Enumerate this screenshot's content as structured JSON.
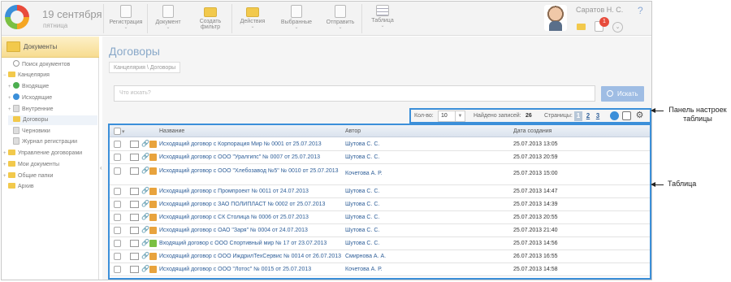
{
  "header": {
    "date": "19 сентября",
    "weekday": "пятница",
    "toolbar": [
      {
        "label": "Регистрация",
        "icon": "register-doc-icon"
      },
      {
        "label": "Документ",
        "icon": "document-icon"
      },
      {
        "label": "Создать\nфильтр",
        "icon": "filter-folder-icon"
      },
      {
        "label": "Действия",
        "icon": "actions-folder-icon"
      },
      {
        "label": "Выбранные",
        "icon": "selected-icon"
      },
      {
        "label": "Отправить",
        "icon": "send-icon"
      },
      {
        "label": "Таблица",
        "icon": "table-icon"
      }
    ],
    "user_name": "Саратов Н. С.",
    "help": "?",
    "tasks_badge": "1"
  },
  "sidebar": {
    "title": "Документы",
    "items": [
      {
        "label": "Поиск документов",
        "level": 1,
        "icon": "search"
      },
      {
        "label": "Канцелярия",
        "level": 0,
        "icon": "folder",
        "pm": "−"
      },
      {
        "label": "Входящие",
        "level": 1,
        "icon": "incoming",
        "pm": "+"
      },
      {
        "label": "Исходящие",
        "level": 1,
        "icon": "outgoing",
        "pm": "+"
      },
      {
        "label": "Внутренние",
        "level": 1,
        "icon": "doc",
        "pm": "+"
      },
      {
        "label": "Договоры",
        "level": 1,
        "icon": "folder",
        "active": true
      },
      {
        "label": "Черновики",
        "level": 1,
        "icon": "doc"
      },
      {
        "label": "Журнал регистрации",
        "level": 1,
        "icon": "doc"
      },
      {
        "label": "Управление договорами",
        "level": 0,
        "icon": "folder",
        "pm": "+"
      },
      {
        "label": "Мои документы",
        "level": 0,
        "icon": "folder",
        "pm": "+"
      },
      {
        "label": "Общие папки",
        "level": 0,
        "icon": "folder",
        "pm": "+"
      },
      {
        "label": "Архив",
        "level": 0,
        "icon": "folder"
      }
    ]
  },
  "main": {
    "title": "Договоры",
    "breadcrumb": "Канцелярия \\ Договоры",
    "search_placeholder": "Что искать?",
    "search_button": "Искать"
  },
  "settings_panel": {
    "qty_label": "Кол-во:",
    "qty_value": "10",
    "found_label": "Найдено записей:",
    "found_count": "26",
    "pages_label": "Страницы:",
    "pages": [
      "1",
      "2",
      "3"
    ],
    "current_page": "1"
  },
  "table": {
    "columns": [
      "Название",
      "Автор",
      "Дата создания"
    ],
    "rows": [
      {
        "name": "Исходящий договор с Корпорация Мир № 0001 от 25.07.2013",
        "author": "Шутова С. С.",
        "date": "25.07.2013 13:05",
        "type": "out"
      },
      {
        "name": "Исходящий договор с ООО \"Уралгипс\" № 0007 от 25.07.2013",
        "author": "Шутова С. С.",
        "date": "25.07.2013 20:59",
        "type": "out"
      },
      {
        "name": "Исходящий договор с ООО \"Хлебозавод №5\" № 0010 от 25.07.2013",
        "author": "Кочетова А. Р.",
        "date": "25.07.2013 15:00",
        "type": "out",
        "tall": true
      },
      {
        "name": "Исходящий договор с Промпроект № 0011 от 24.07.2013",
        "author": "Шутова С. С.",
        "date": "25.07.2013 14:47",
        "type": "out"
      },
      {
        "name": "Исходящий договор с ЗАО ПОЛИПЛАСТ № 0002 от 25.07.2013",
        "author": "Шутова С. С.",
        "date": "25.07.2013 14:39",
        "type": "out"
      },
      {
        "name": "Исходящий договор с СК Столица № 0006 от 25.07.2013",
        "author": "Шутова С. С.",
        "date": "25.07.2013 20:55",
        "type": "out"
      },
      {
        "name": "Исходящий договор с ОАО \"Заря\" № 0004 от 24.07.2013",
        "author": "Шутова С. С.",
        "date": "25.07.2013 21:40",
        "type": "out"
      },
      {
        "name": "Входящий договор с ООО Спортивный мир № 17 от 23.07.2013",
        "author": "Шутова С. С.",
        "date": "25.07.2013 14:56",
        "type": "in"
      },
      {
        "name": "Исходящий договор с ООО Ижд­рилТехСервис № 0014 от 26.07.2013",
        "author": "Смирнова А. А.",
        "date": "26.07.2013 16:55",
        "type": "out"
      },
      {
        "name": "Исходящий договор с ООО \"Лотос\" № 0015 от 25.07.2013",
        "author": "Кочетова А. Р.",
        "date": "25.07.2013 14:58",
        "type": "out"
      }
    ]
  },
  "annotations": {
    "panel": "Панель настроек\nтаблицы",
    "table": "Таблица"
  }
}
